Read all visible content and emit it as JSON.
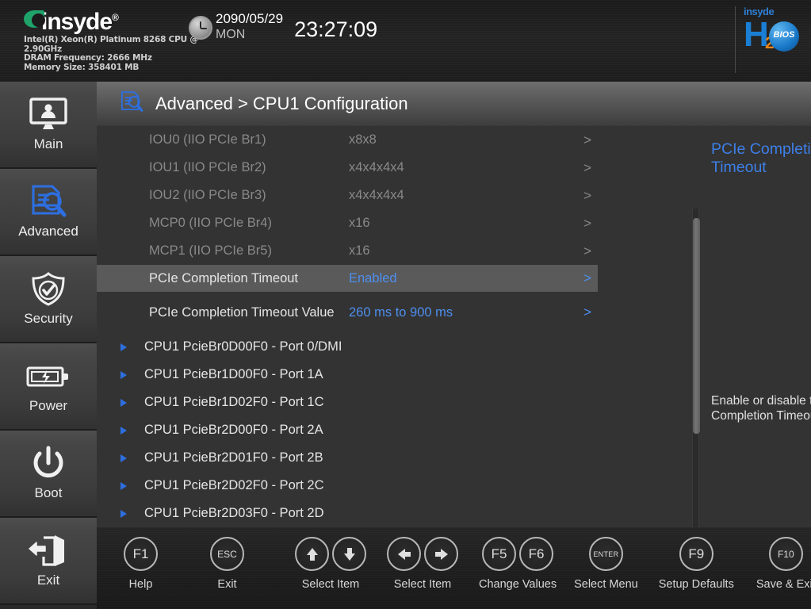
{
  "header": {
    "brand": "insyde",
    "brand_reg": "®",
    "system_info_lines": [
      "Intel(R) Xeon(R) Platinum 8268 CPU @ 2.90GHz",
      "DRAM Frequency: 2666 MHz",
      "Memory Size: 358401 MB"
    ],
    "clock_icon": "clock-icon",
    "date": "2090/05/29",
    "weekday": "MON",
    "time": "23:27:09",
    "logo": {
      "top": "insyde",
      "h": "H",
      "sub": "2",
      "ball": "BIOS"
    }
  },
  "sidebar": {
    "items": [
      {
        "label": "Main",
        "icon": "monitor-user-icon",
        "active": false
      },
      {
        "label": "Advanced",
        "icon": "document-search-icon",
        "active": true
      },
      {
        "label": "Security",
        "icon": "shield-check-icon",
        "active": false
      },
      {
        "label": "Power",
        "icon": "battery-bolt-icon",
        "active": false
      },
      {
        "label": "Boot",
        "icon": "power-icon",
        "active": false
      },
      {
        "label": "Exit",
        "icon": "exit-door-icon",
        "active": false
      }
    ]
  },
  "page": {
    "breadcrumb_icon": "document-search-icon",
    "breadcrumb": "Advanced > CPU1 Configuration"
  },
  "settings": {
    "arrow_glyph": ">",
    "rows": [
      {
        "label": "IOU0 (IIO PCIe Br1)",
        "value": "x8x8",
        "type": "option",
        "disabled": true,
        "selected": false
      },
      {
        "label": "IOU1 (IIO PCIe Br2)",
        "value": "x4x4x4x4",
        "type": "option",
        "disabled": true,
        "selected": false
      },
      {
        "label": "IOU2 (IIO PCIe Br3)",
        "value": "x4x4x4x4",
        "type": "option",
        "disabled": true,
        "selected": false
      },
      {
        "label": "MCP0 (IIO PCIe Br4)",
        "value": "x16",
        "type": "option",
        "disabled": true,
        "selected": false
      },
      {
        "label": "MCP1 (IIO PCIe Br5)",
        "value": "x16",
        "type": "option",
        "disabled": true,
        "selected": false
      },
      {
        "label": "PCIe Completion Timeout",
        "value": "Enabled",
        "type": "option",
        "disabled": false,
        "selected": true
      },
      {
        "label": "PCIe Completion Timeout Value",
        "value": "260 ms to 900 ms",
        "type": "option",
        "disabled": false,
        "selected": false
      },
      {
        "label": "CPU1 PcieBr0D00F0 - Port 0/DMI",
        "value": "",
        "type": "submenu",
        "disabled": false,
        "selected": false
      },
      {
        "label": "CPU1 PcieBr1D00F0 - Port 1A",
        "value": "",
        "type": "submenu",
        "disabled": false,
        "selected": false
      },
      {
        "label": "CPU1 PcieBr1D02F0 - Port 1C",
        "value": "",
        "type": "submenu",
        "disabled": false,
        "selected": false
      },
      {
        "label": "CPU1 PcieBr2D00F0 - Port 2A",
        "value": "",
        "type": "submenu",
        "disabled": false,
        "selected": false
      },
      {
        "label": "CPU1 PcieBr2D01F0 - Port 2B",
        "value": "",
        "type": "submenu",
        "disabled": false,
        "selected": false
      },
      {
        "label": "CPU1 PcieBr2D02F0 - Port 2C",
        "value": "",
        "type": "submenu",
        "disabled": false,
        "selected": false
      },
      {
        "label": "CPU1 PcieBr2D03F0 - Port 2D",
        "value": "",
        "type": "submenu",
        "disabled": false,
        "selected": false
      }
    ]
  },
  "help": {
    "title": "PCIe Completion Timeout",
    "icon": "document-search-icon",
    "body": "Enable or disable the PCIe Completion Timeout."
  },
  "footer": {
    "groups": [
      {
        "keys": [
          "F1"
        ],
        "key_style": "normal",
        "caption": "Help"
      },
      {
        "keys": [
          "ESC"
        ],
        "key_style": "small",
        "caption": "Exit"
      },
      {
        "keys": [
          "↑",
          "↓"
        ],
        "key_style": "arrow",
        "caption": "Select Item"
      },
      {
        "keys": [
          "←",
          "→"
        ],
        "key_style": "arrow",
        "caption": "Select Item"
      },
      {
        "keys": [
          "F5",
          "F6"
        ],
        "key_style": "normal",
        "caption": "Change Values"
      },
      {
        "keys": [
          "ENTER"
        ],
        "key_style": "tiny",
        "caption": "Select Menu"
      },
      {
        "keys": [
          "F9"
        ],
        "key_style": "normal",
        "caption": "Setup Defaults"
      },
      {
        "keys": [
          "F10"
        ],
        "key_style": "normal",
        "caption": "Save & Exit"
      }
    ]
  },
  "colors": {
    "accent_blue": "#4e8ff0",
    "help_blue": "#3d7fe8",
    "selected_row": "#5a5a5a",
    "disabled_text": "#898989",
    "panel_bg": "#333333",
    "logo_green": "#1fa36b",
    "logo_orange": "#e8861a"
  }
}
